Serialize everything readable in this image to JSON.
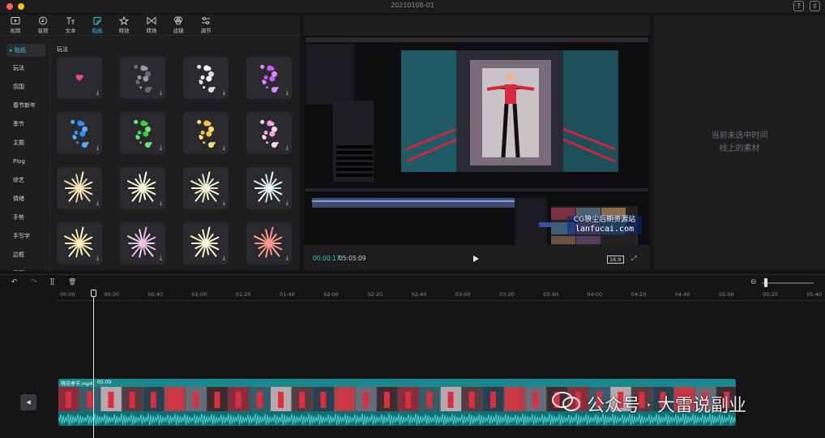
{
  "window": {
    "title": "20210108-01",
    "controls": [
      "close",
      "minimize",
      "maximize"
    ],
    "colors": {
      "close": "#fe5f57",
      "minimize": "#febc2e",
      "maximize": "#28c840"
    }
  },
  "titlebar_buttons": {
    "help": "?",
    "share": "⇪"
  },
  "toolbar": {
    "items": [
      {
        "label": "视频",
        "icon": "video-icon"
      },
      {
        "label": "音频",
        "icon": "audio-icon"
      },
      {
        "label": "文本",
        "icon": "text-icon"
      },
      {
        "label": "贴纸",
        "icon": "sticker-icon",
        "active": true
      },
      {
        "label": "特效",
        "icon": "effects-icon"
      },
      {
        "label": "转场",
        "icon": "transition-icon"
      },
      {
        "label": "滤镜",
        "icon": "filter-icon"
      },
      {
        "label": "调节",
        "icon": "adjust-icon"
      }
    ]
  },
  "categories": [
    {
      "label": "贴纸",
      "active": true,
      "marker": "▸"
    },
    {
      "label": "玩法"
    },
    {
      "label": "氛围"
    },
    {
      "label": "春节新年"
    },
    {
      "label": "季节"
    },
    {
      "label": "主题"
    },
    {
      "label": "Plog"
    },
    {
      "label": "综艺"
    },
    {
      "label": "情绪"
    },
    {
      "label": "手势"
    },
    {
      "label": "手写字"
    },
    {
      "label": "边框"
    },
    {
      "label": "界面"
    }
  ],
  "grid": {
    "title": "玩法",
    "download_icon": "⤓"
  },
  "player": {
    "current_time": "00:00:17",
    "duration": "05:05:09",
    "ratio": "16:9",
    "fullscreen_icon": "⤢",
    "overlay_text_line1": "CG狼尘后期资源站",
    "overlay_text_line2": "lanfucai.com"
  },
  "properties": {
    "empty_line1": "当前未选中时间",
    "empty_line2": "线上的素材"
  },
  "timeline_toolbar": {
    "undo": "↶",
    "redo": "↷",
    "split": "][",
    "delete": "🗑",
    "zoom_out": "⊖",
    "zoom_level": 0.05
  },
  "ruler": [
    "00:00",
    "00:20",
    "00:40",
    "01:00",
    "01:20",
    "01:40",
    "02:00",
    "02:20",
    "02:40",
    "03:00",
    "03:20",
    "03:40",
    "04:00",
    "04:20",
    "04:40",
    "05:00",
    "05:20",
    "05:40"
  ],
  "clip": {
    "name": "桃花季节.mp4",
    "duration": "05:09",
    "color": "#0f6f72"
  },
  "track_side_icon": "◂",
  "watermark": {
    "text": "公众号 · 大雷说副业"
  }
}
